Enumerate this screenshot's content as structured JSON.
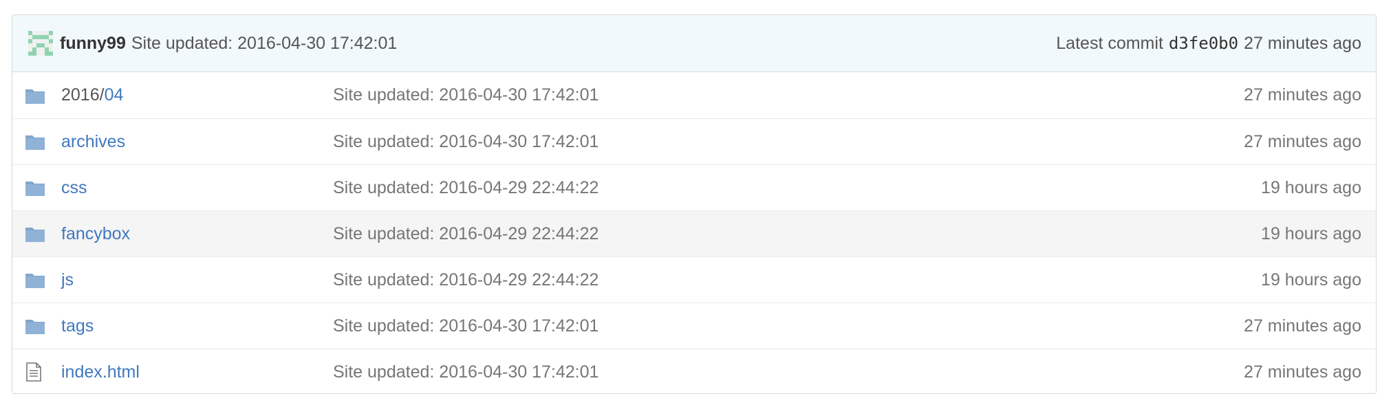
{
  "commit_tease": {
    "author": "funny99",
    "message": "Site updated: 2016-04-30 17:42:01",
    "latest_label": "Latest commit",
    "sha": "d3fe0b0",
    "age": "27 minutes ago"
  },
  "colors": {
    "link": "#4078c0",
    "folder_icon": "#80a6cd",
    "header_bg": "#f2f9fc",
    "hover_row_bg": "#f5f5f5"
  },
  "files": [
    {
      "icon": "folder-icon",
      "prefix": "2016/",
      "name": "04",
      "message": "Site updated: 2016-04-30 17:42:01",
      "age": "27 minutes ago"
    },
    {
      "icon": "folder-icon",
      "prefix": "",
      "name": "archives",
      "message": "Site updated: 2016-04-30 17:42:01",
      "age": "27 minutes ago"
    },
    {
      "icon": "folder-icon",
      "prefix": "",
      "name": "css",
      "message": "Site updated: 2016-04-29 22:44:22",
      "age": "19 hours ago"
    },
    {
      "icon": "folder-icon",
      "prefix": "",
      "name": "fancybox",
      "message": "Site updated: 2016-04-29 22:44:22",
      "age": "19 hours ago"
    },
    {
      "icon": "folder-icon",
      "prefix": "",
      "name": "js",
      "message": "Site updated: 2016-04-29 22:44:22",
      "age": "19 hours ago"
    },
    {
      "icon": "folder-icon",
      "prefix": "",
      "name": "tags",
      "message": "Site updated: 2016-04-30 17:42:01",
      "age": "27 minutes ago"
    },
    {
      "icon": "file-text-icon",
      "prefix": "",
      "name": "index.html",
      "message": "Site updated: 2016-04-30 17:42:01",
      "age": "27 minutes ago"
    }
  ]
}
